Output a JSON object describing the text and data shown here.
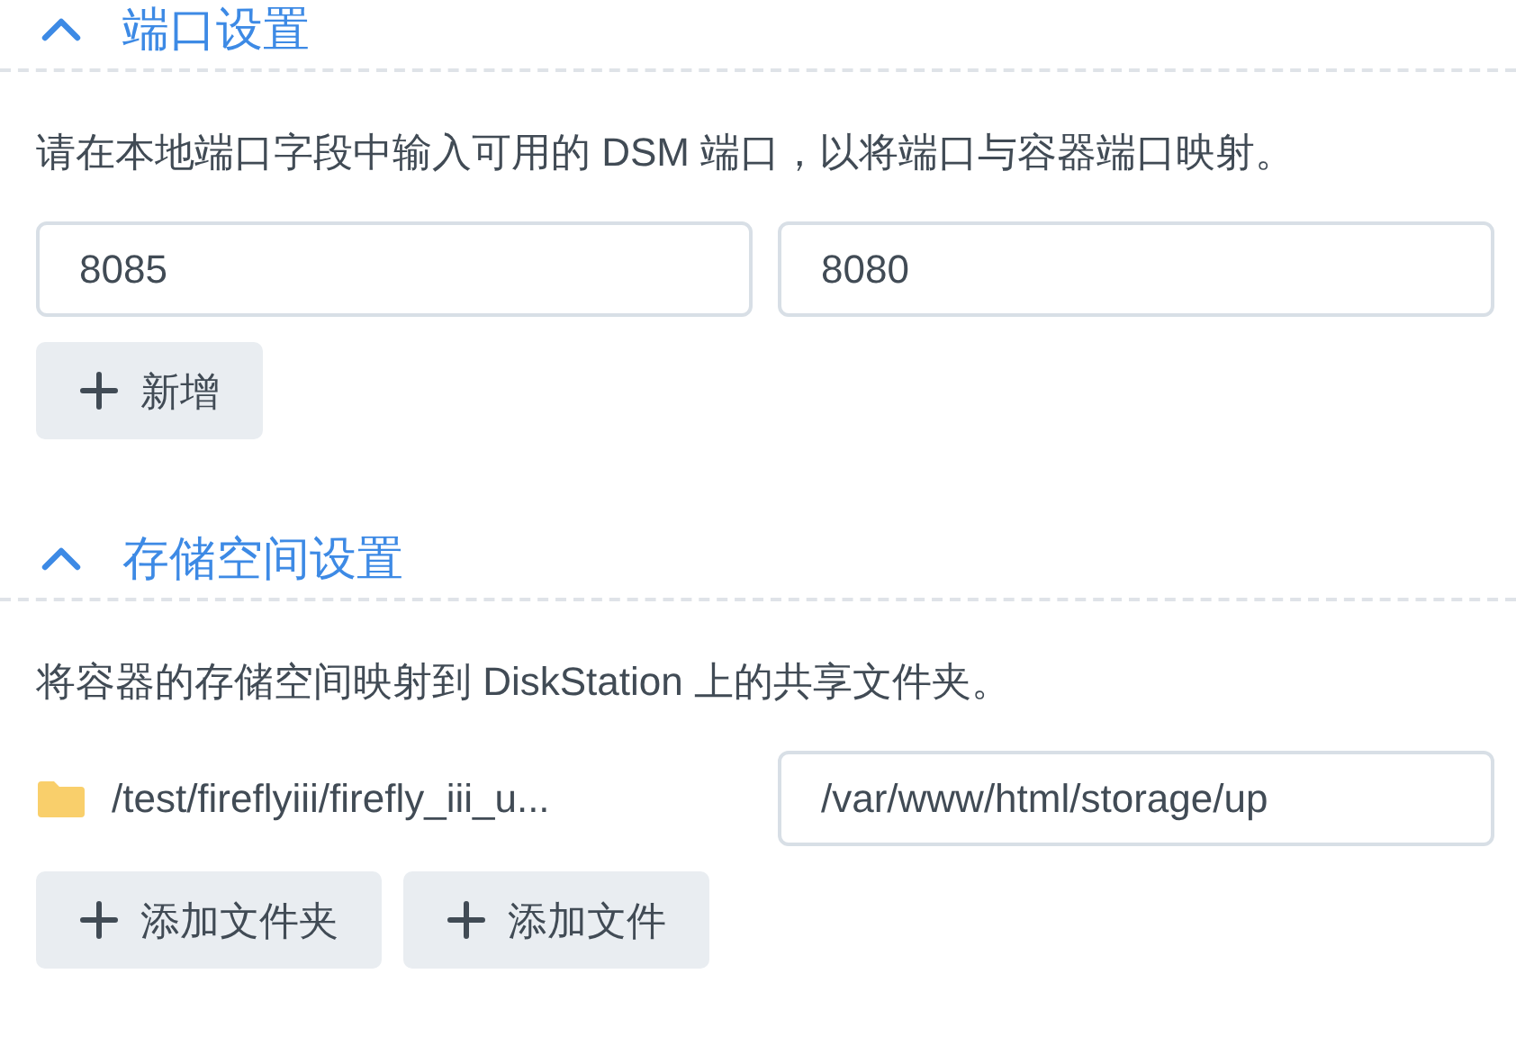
{
  "sections": [
    {
      "kind": "ports",
      "title": "端口设置",
      "expanded": true,
      "description": "请在本地端口字段中输入可用的 DSM 端口，以将端口与容器端口映射。",
      "local_port": "8085",
      "container_port": "8080",
      "buttons": [
        "新增"
      ]
    },
    {
      "kind": "storage",
      "title": "存储空间设置",
      "expanded": true,
      "description": "将容器的存储空间映射到 DiskStation 上的共享文件夹。",
      "folder_path": "/test/fireflyiii/firefly_iii_u...",
      "mount_path": "/var/www/html/storage/up",
      "buttons": [
        "添加文件夹",
        "添加文件"
      ]
    }
  ]
}
